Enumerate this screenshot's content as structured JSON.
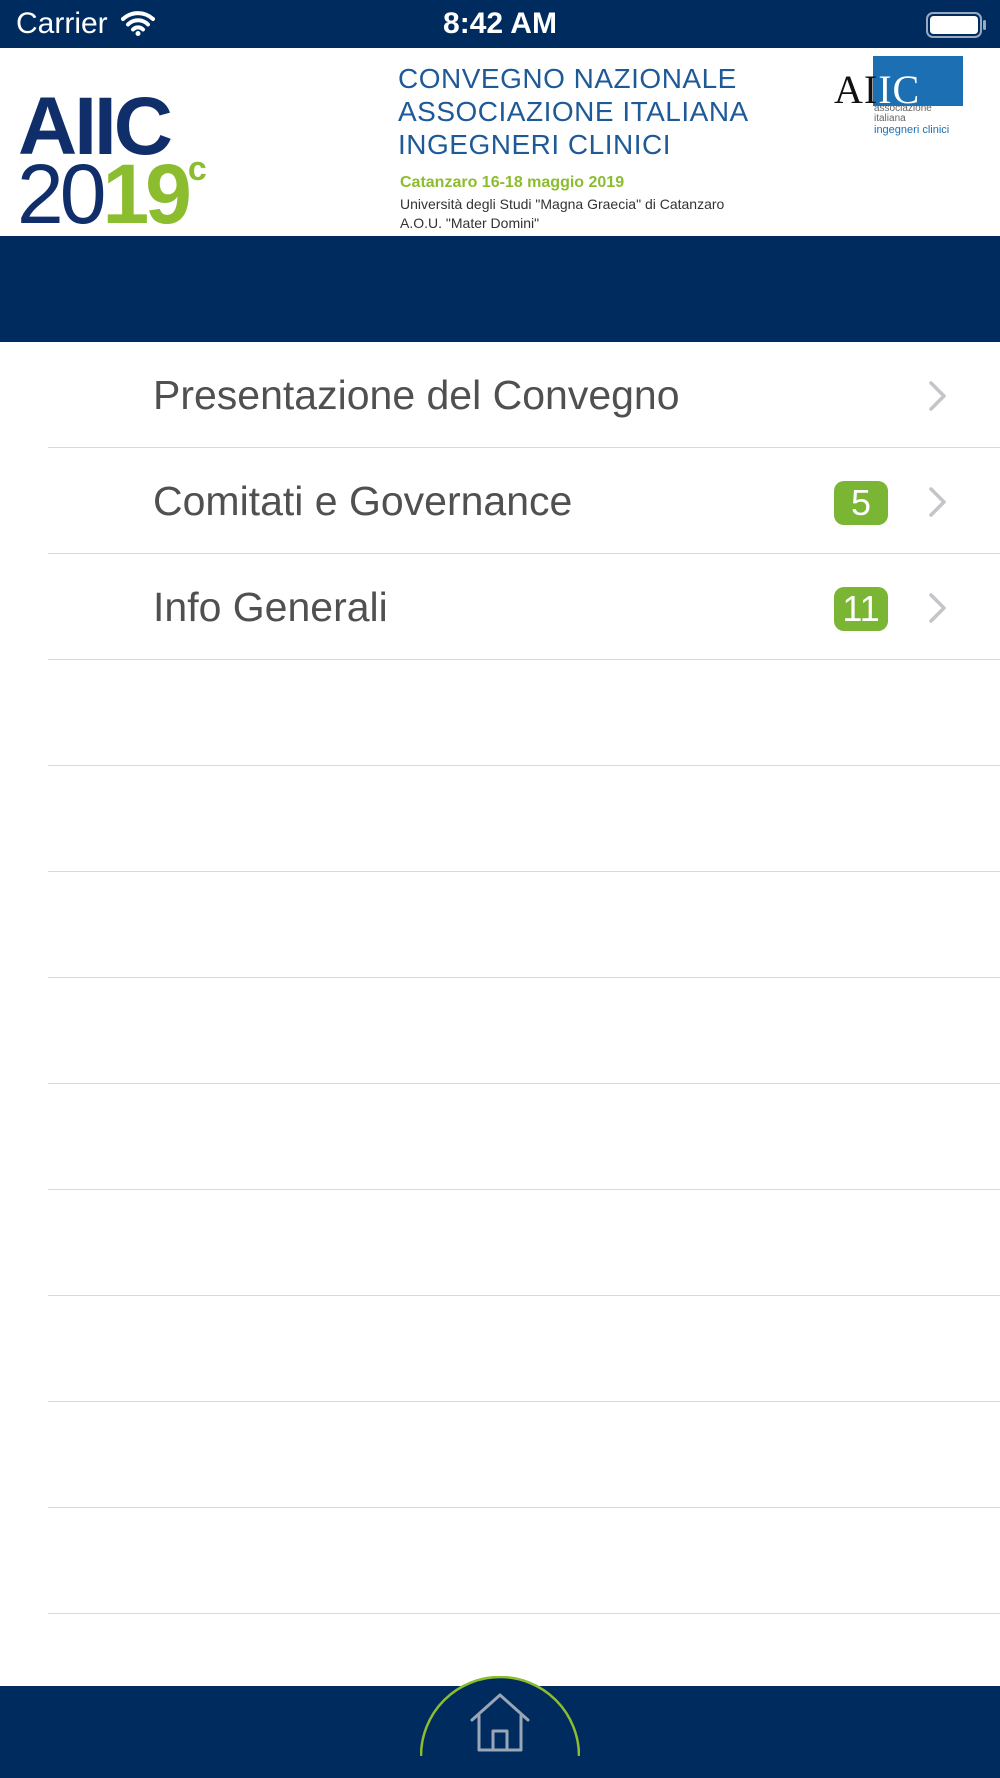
{
  "status_bar": {
    "carrier": "Carrier",
    "time": "8:42 AM"
  },
  "banner": {
    "logo_text": "AIIC",
    "logo_year_navy": "20",
    "logo_year_green": "19",
    "logo_year_mark": "c",
    "title_lines": [
      "CONVEGNO NAZIONALE",
      "ASSOCIAZIONE ITALIANA",
      "INGEGNERI CLINICI"
    ],
    "dates": "Catanzaro 16-18 maggio 2019",
    "venue_line1": "Università degli Studi \"Magna Graecia\" di Catanzaro",
    "venue_line2": "A.O.U. \"Mater Domini\"",
    "partner_logo_left": "AI",
    "partner_logo_right": "IC",
    "partner_sub1": "associazione",
    "partner_sub2": "italiana",
    "partner_sub3": "ingegneri clinici"
  },
  "menu": {
    "items": [
      {
        "label": "Presentazione del Convegno",
        "badge": ""
      },
      {
        "label": "Comitati e Governance",
        "badge": "5"
      },
      {
        "label": "Info Generali",
        "badge": "11"
      }
    ]
  },
  "icons": {
    "wifi": "wifi-icon",
    "battery": "battery-icon",
    "chevron": "chevron-right-icon",
    "home": "home-icon"
  },
  "colors": {
    "navy": "#002b5e",
    "badge_green": "#7ab534",
    "accent_green": "#8cbd2f"
  }
}
